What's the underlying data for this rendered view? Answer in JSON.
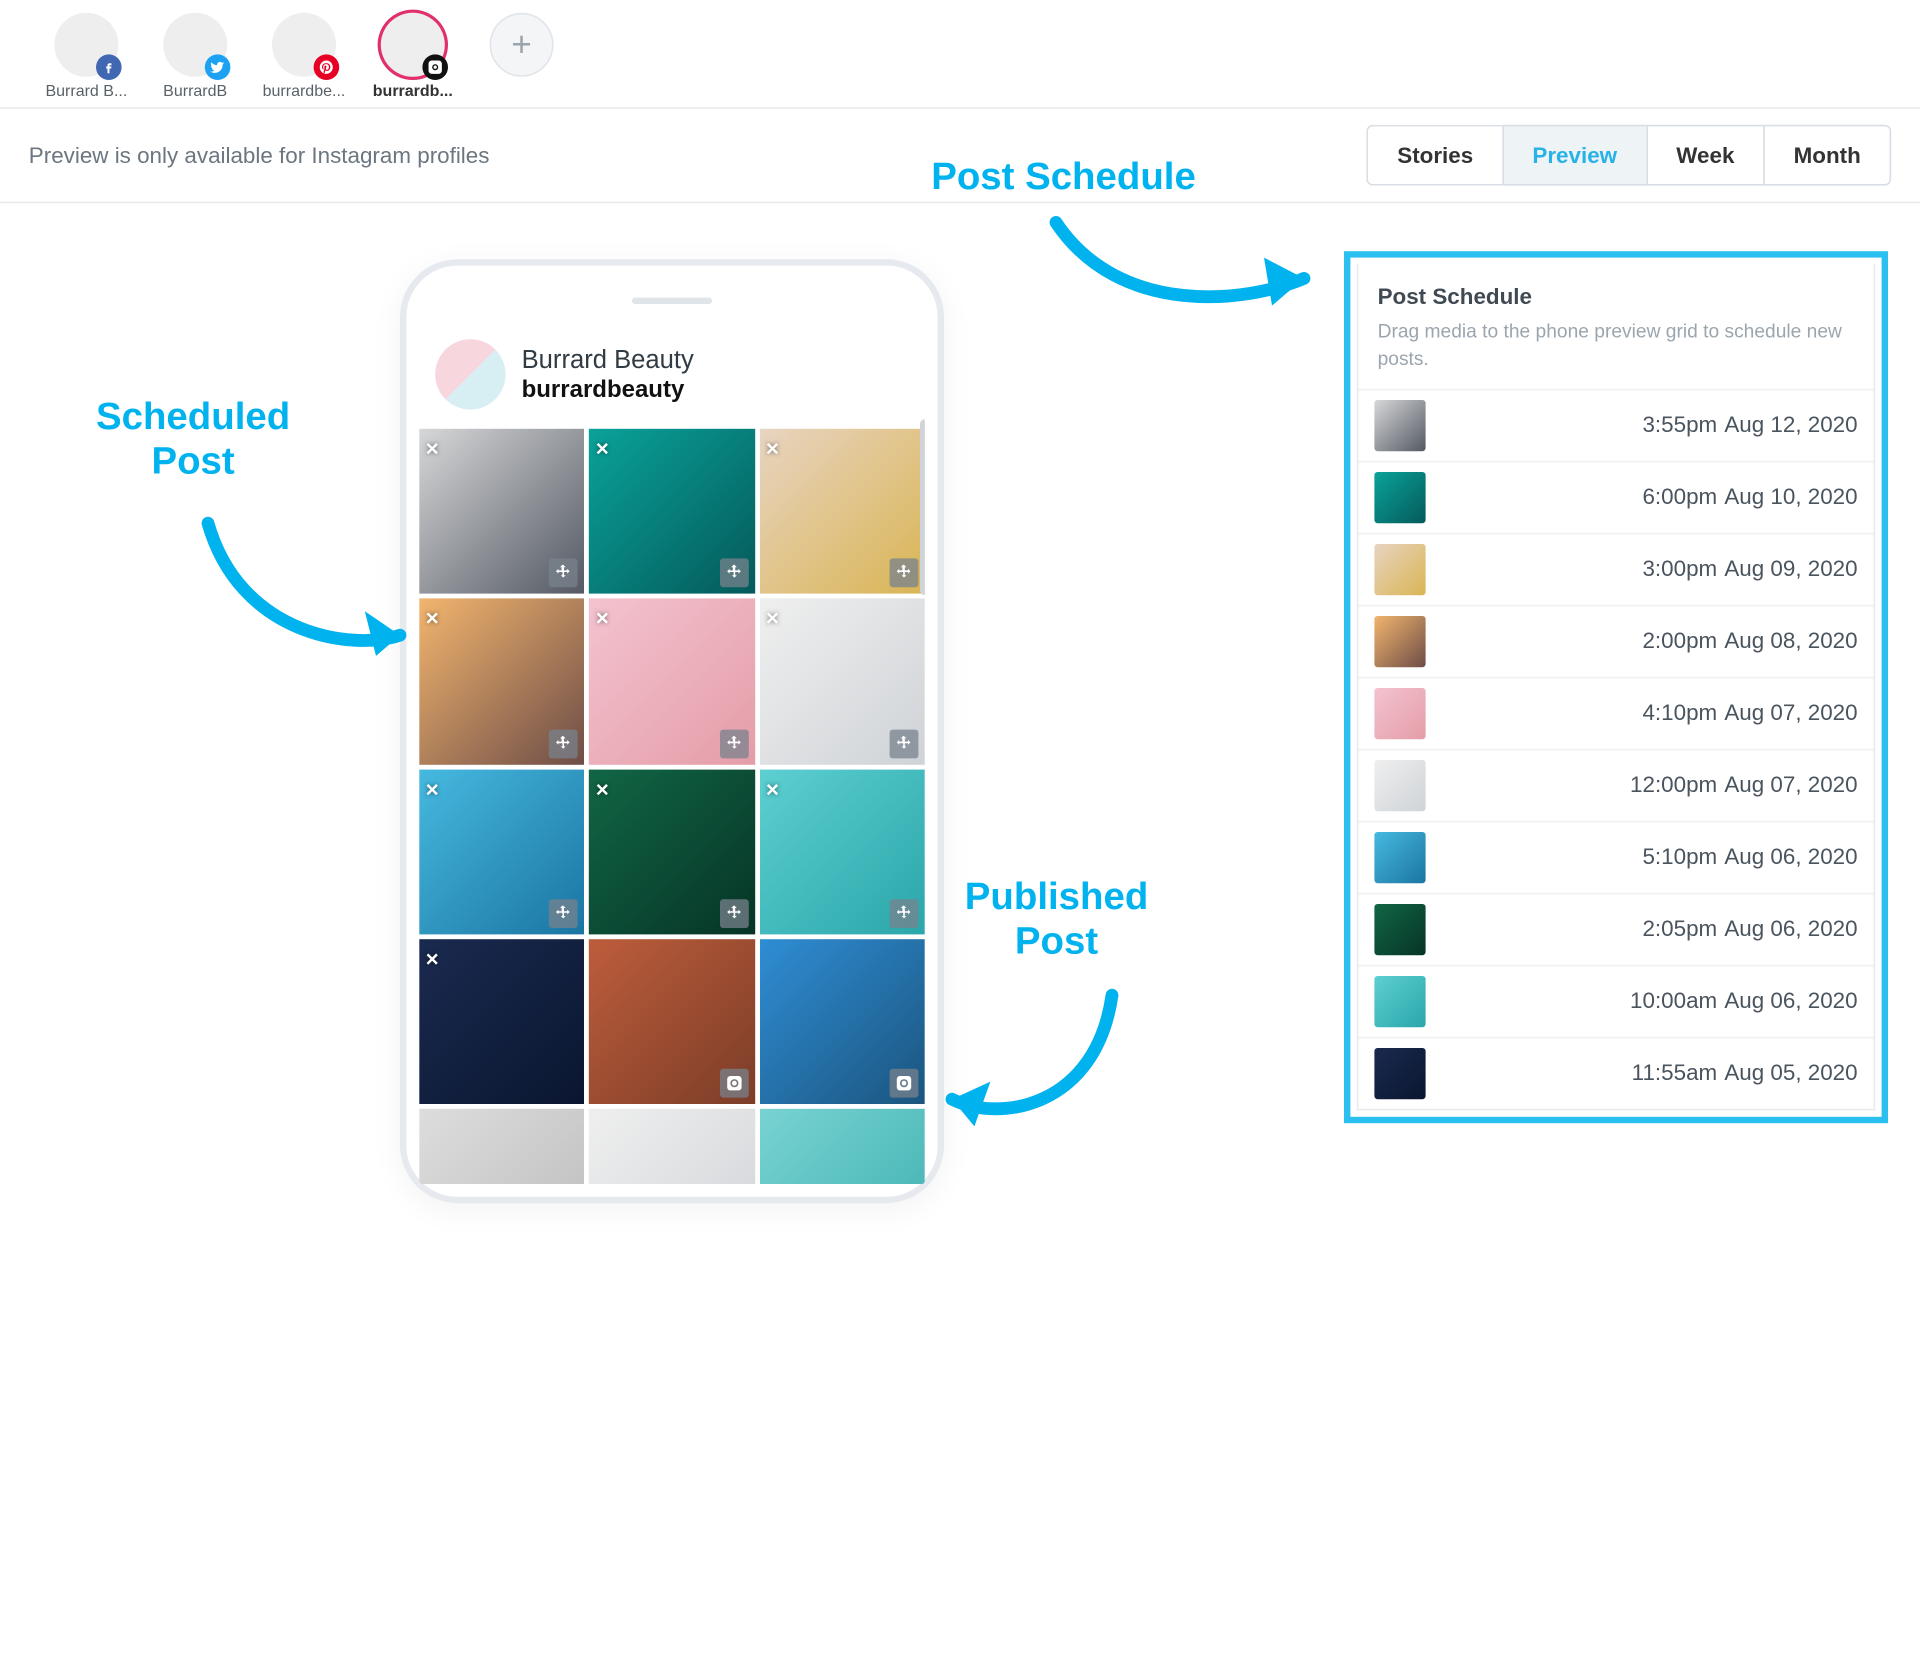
{
  "profiles": [
    {
      "label": "Burrard B...",
      "network": "facebook"
    },
    {
      "label": "BurrardB",
      "network": "twitter"
    },
    {
      "label": "burrardbe...",
      "network": "pinterest"
    },
    {
      "label": "burrardb...",
      "network": "instagram",
      "active": true
    }
  ],
  "sub_note": "Preview is only available for Instagram profiles",
  "view_tabs": {
    "stories": "Stories",
    "preview": "Preview",
    "week": "Week",
    "month": "Month",
    "active": "preview"
  },
  "instagram": {
    "display_name": "Burrard Beauty",
    "handle": "burrardbeauty"
  },
  "schedule": {
    "title": "Post Schedule",
    "help": "Drag media to the phone preview grid to schedule new posts.",
    "items": [
      {
        "time": "3:55pm",
        "date": "Aug 12, 2020",
        "sw": "th-a"
      },
      {
        "time": "6:00pm",
        "date": "Aug 10, 2020",
        "sw": "th-b"
      },
      {
        "time": "3:00pm",
        "date": "Aug 09, 2020",
        "sw": "th-c"
      },
      {
        "time": "2:00pm",
        "date": "Aug 08, 2020",
        "sw": "th-d"
      },
      {
        "time": "4:10pm",
        "date": "Aug 07, 2020",
        "sw": "th-e"
      },
      {
        "time": "12:00pm",
        "date": "Aug 07, 2020",
        "sw": "th-f"
      },
      {
        "time": "5:10pm",
        "date": "Aug 06, 2020",
        "sw": "th-g"
      },
      {
        "time": "2:05pm",
        "date": "Aug 06, 2020",
        "sw": "th-h"
      },
      {
        "time": "10:00am",
        "date": "Aug 06, 2020",
        "sw": "th-i"
      },
      {
        "time": "11:55am",
        "date": "Aug 05, 2020",
        "sw": "th-j"
      }
    ]
  },
  "grid": [
    {
      "sw": "th-a",
      "state": "scheduled"
    },
    {
      "sw": "th-b",
      "state": "scheduled"
    },
    {
      "sw": "th-c",
      "state": "scheduled"
    },
    {
      "sw": "th-d",
      "state": "scheduled"
    },
    {
      "sw": "th-e",
      "state": "scheduled"
    },
    {
      "sw": "th-f",
      "state": "scheduled"
    },
    {
      "sw": "th-g",
      "state": "scheduled"
    },
    {
      "sw": "th-h",
      "state": "scheduled"
    },
    {
      "sw": "th-i",
      "state": "scheduled"
    },
    {
      "sw": "th-j",
      "state": "scheduled-nomove"
    },
    {
      "sw": "th-k",
      "state": "published"
    },
    {
      "sw": "th-l",
      "state": "published"
    },
    {
      "sw": "th-m",
      "state": "plain"
    },
    {
      "sw": "th-f",
      "state": "plain"
    },
    {
      "sw": "th-n",
      "state": "plain"
    }
  ],
  "annotations": {
    "scheduled": "Scheduled\nPost",
    "published": "Published\nPost",
    "postschedule": "Post Schedule"
  },
  "icons": {
    "close": "×"
  }
}
